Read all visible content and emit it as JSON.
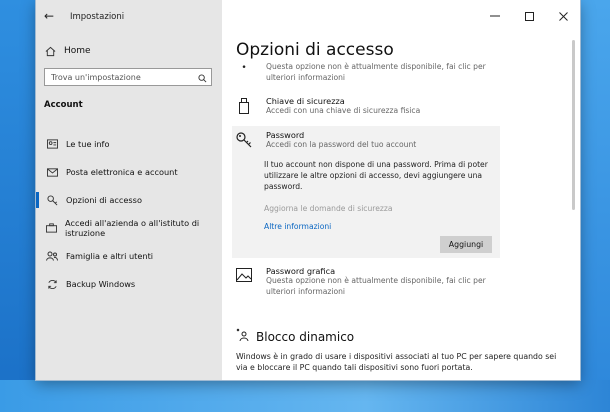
{
  "window": {
    "app_title": "Impostazioni"
  },
  "sidebar": {
    "home_label": "Home",
    "search_placeholder": "Trova un'impostazione",
    "section_title": "Account",
    "items": [
      {
        "label": "Le tue info",
        "icon": "person-card-icon"
      },
      {
        "label": "Posta elettronica e account",
        "icon": "mail-icon"
      },
      {
        "label": "Opzioni di accesso",
        "icon": "key-icon",
        "active": true
      },
      {
        "label": "Accedi all'azienda o all'istituto di istruzione",
        "icon": "briefcase-icon"
      },
      {
        "label": "Famiglia e altri utenti",
        "icon": "people-icon"
      },
      {
        "label": "Backup Windows",
        "icon": "sync-icon"
      }
    ]
  },
  "main": {
    "page_title": "Opzioni di accesso",
    "top_desc_1": "Questa opzione non è attualmente disponibile, fai clic per",
    "top_desc_2": "ulteriori informazioni",
    "security_key": {
      "title": "Chiave di sicurezza",
      "desc": "Accedi con una chiave di sicurezza fisica"
    },
    "password": {
      "title": "Password",
      "desc": "Accedi con la password del tuo account",
      "text": "Il tuo account non dispone di una password. Prima di poter utilizzare le altre opzioni di accesso, devi aggiungere una password.",
      "security_questions": "Aggiorna le domande di sicurezza",
      "more_info": "Altre informazioni",
      "add_button": "Aggiungi"
    },
    "picture_password": {
      "title": "Password grafica",
      "desc_1": "Questa opzione non è attualmente disponibile, fai clic per",
      "desc_2": "ulteriori informazioni"
    },
    "dynamic_lock": {
      "title": "Blocco dinamico",
      "text": "Windows è in grado di usare i dispositivi associati al tuo PC per sapere quando sei via e bloccare il PC quando tali dispositivi sono fuori portata."
    }
  },
  "colors": {
    "accent": "#0a66c2",
    "sidebar_bg": "#e6e6e6",
    "panel_bg": "#f2f2f2"
  }
}
